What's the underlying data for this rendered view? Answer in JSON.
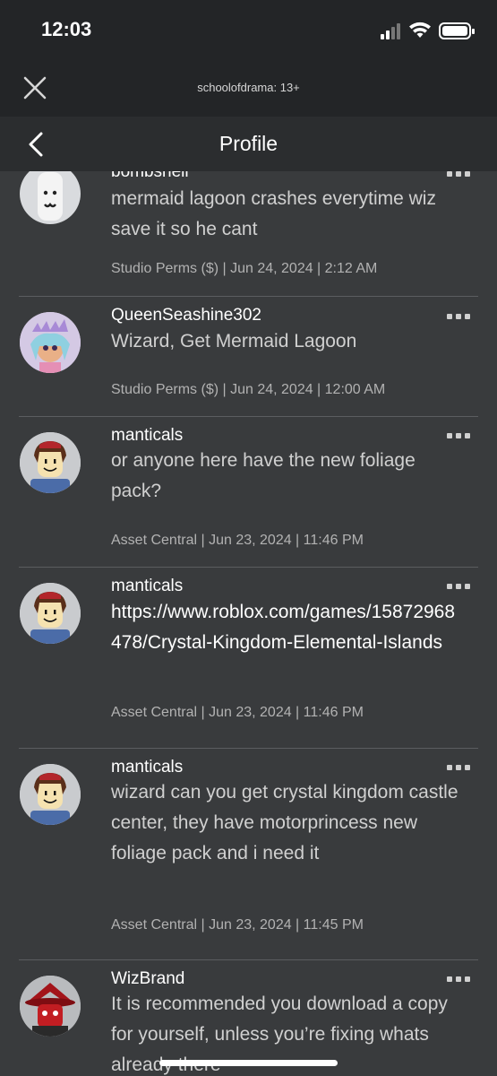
{
  "status_bar": {
    "time": "12:03"
  },
  "header": {
    "game_title": "schoolofdrama: 13+"
  },
  "nav": {
    "title": "Profile"
  },
  "posts": [
    {
      "username": "bombshell",
      "message": "mermaid lagoon crashes everytime wiz save it so he cant",
      "meta": "Studio Perms ($) | Jun 24, 2024 | 2:12 AM",
      "avatar_icon": "ghost-avatar-icon"
    },
    {
      "username": "QueenSeashine302",
      "message": "Wizard, Get Mermaid Lagoon",
      "meta": "Studio Perms ($) | Jun 24, 2024 | 12:00 AM",
      "avatar_icon": "mermaid-avatar-icon"
    },
    {
      "username": "manticals",
      "message": "or anyone here have the new foliage pack?",
      "meta": "Asset Central | Jun 23, 2024 | 11:46 PM",
      "avatar_icon": "robloxian-avatar-icon"
    },
    {
      "username": "manticals",
      "message": "https://www.roblox.com/games/15872968478/Crystal-Kingdom-Elemental-Islands",
      "meta": "Asset Central | Jun 23, 2024 | 11:46 PM",
      "avatar_icon": "robloxian-avatar-icon"
    },
    {
      "username": "manticals",
      "message": "wizard can you get crystal kingdom castle center, they have motorprincess new foliage pack and i need it",
      "meta": "Asset Central | Jun 23, 2024 | 11:45 PM",
      "avatar_icon": "robloxian-avatar-icon"
    },
    {
      "username": "WizBrand",
      "message": "It is recommended you download a copy for yourself, unless you’re fixing whats already there",
      "meta": "",
      "avatar_icon": "red-wizard-avatar-icon"
    }
  ],
  "colors": {
    "background": "#393b3d",
    "header": "#232527",
    "divider": "#5b5d60"
  }
}
